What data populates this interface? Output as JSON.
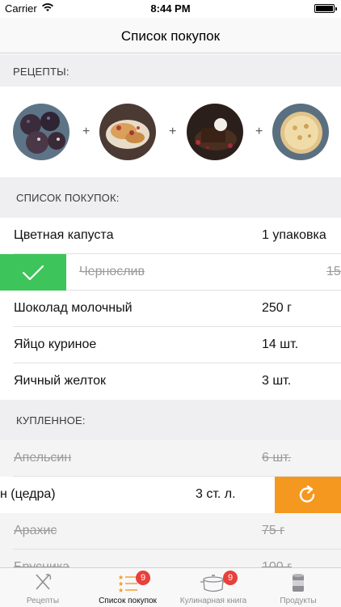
{
  "status_bar": {
    "carrier": "Carrier",
    "time": "8:44 PM"
  },
  "nav": {
    "title": "Список покупок"
  },
  "recipes_section": {
    "header": "РЕЦЕПТЫ:",
    "plus_sign": "+"
  },
  "shopping_section": {
    "header": "СПИСОК ПОКУПОК:",
    "items": [
      {
        "name": "Цветная капуста",
        "qty": "1 упаковка"
      },
      {
        "name": "Чернослив",
        "qty": "15"
      },
      {
        "name": "Шоколад молочный",
        "qty": "250 г"
      },
      {
        "name": "Яйцо куриное",
        "qty": "14 шт."
      },
      {
        "name": "Яичный желток",
        "qty": "3 шт."
      }
    ]
  },
  "bought_section": {
    "header": "КУПЛЕННОЕ:",
    "items": [
      {
        "name": "Апельсин",
        "qty": "6 шт."
      },
      {
        "name": "н (цедра)",
        "qty": "3 ст. л."
      },
      {
        "name": "Арахис",
        "qty": "75 г"
      },
      {
        "name": "Брусника",
        "qty": "100 г"
      }
    ]
  },
  "tabs": [
    {
      "label": "Рецепты",
      "icon": "fork-knife-icon",
      "badge": ""
    },
    {
      "label": "Список покупок",
      "icon": "list-icon",
      "badge": "9"
    },
    {
      "label": "Кулинарная книга",
      "icon": "pot-icon",
      "badge": "9"
    },
    {
      "label": "Продукты",
      "icon": "can-icon",
      "badge": ""
    }
  ],
  "colors": {
    "check_green": "#3dc45b",
    "restore_orange": "#f5981f",
    "badge_red": "#e8403a",
    "section_bg": "#efeff1"
  }
}
